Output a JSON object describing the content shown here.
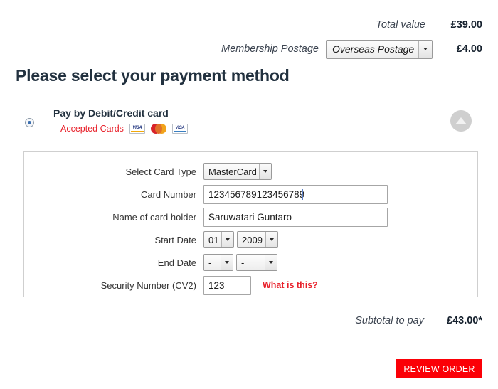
{
  "summary": {
    "rows": [
      {
        "label": "Total value",
        "amount": "£39.00"
      },
      {
        "label": "Membership Postage",
        "amount": "£4.00",
        "select_value": "Overseas Postage"
      }
    ]
  },
  "page_title": "Please select your payment method",
  "method_panel": {
    "title": "Pay by Debit/Credit card",
    "accepted_label": "Accepted Cards",
    "cards": [
      "visa",
      "mastercard",
      "visa-electron"
    ],
    "radio_selected": true,
    "collapse_icon": "triangle-up-icon"
  },
  "form": {
    "card_type": {
      "label": "Select Card Type",
      "value": "MasterCard"
    },
    "card_number": {
      "label": "Card Number",
      "value": "123456789123456789"
    },
    "card_holder": {
      "label": "Name of card holder",
      "value": "Saruwatari Guntaro"
    },
    "start_date": {
      "label": "Start Date",
      "month": "01",
      "year": "2009"
    },
    "end_date": {
      "label": "End Date",
      "month": "-",
      "year": "-"
    },
    "security": {
      "label": "Security Number (CV2)",
      "value": "123",
      "help_link": "What is this?"
    }
  },
  "subtotal": {
    "label": "Subtotal to pay",
    "amount": "£43.00*"
  },
  "review_button": {
    "label": "REVIEW ORDER"
  },
  "colors": {
    "accent_red": "#e8202a",
    "button_red": "#fb0007",
    "heading_navy": "#22313f",
    "border_gray": "#cfcfcf"
  }
}
